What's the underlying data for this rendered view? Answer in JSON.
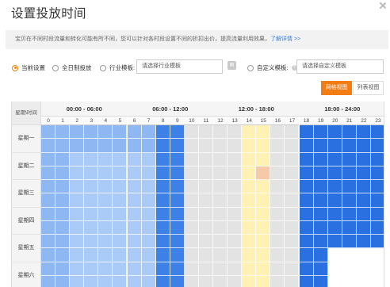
{
  "dialog": {
    "title": "设置投放时间"
  },
  "notice": {
    "text": "宝贝在不同时段流量和转化可能有所不同，您可以针对各时段设置不同的折扣出价，提高流量利用效果，",
    "link": "了解详情 >>"
  },
  "options": {
    "current": "当前设置",
    "allday": "全日制投放",
    "industry": "行业模板:",
    "industry_placeholder": "请选择行业模板",
    "custom": "自定义模板:",
    "custom_placeholder": "请选择自定义模板",
    "selected": "current"
  },
  "view": {
    "grid": "网格视图",
    "list": "列表视图",
    "active": "grid"
  },
  "schedule": {
    "corner": "星期\\时间",
    "quarters": [
      "00:00 - 06:00",
      "06:00 - 12:00",
      "12:00 - 18:00",
      "18:00 - 24:00"
    ],
    "hours": [
      "0",
      "1",
      "2",
      "3",
      "4",
      "5",
      "6",
      "7",
      "8",
      "9",
      "10",
      "11",
      "12",
      "13",
      "14",
      "15",
      "16",
      "17",
      "18",
      "19",
      "20",
      "21",
      "22",
      "23"
    ],
    "days": [
      "星期一",
      "星期二",
      "星期三",
      "星期四",
      "星期五",
      "星期六"
    ],
    "hour_colors": [
      "#8fb7f2",
      "#8fb7f2",
      "#aacbf7",
      "#aacbf7",
      "#aacbf7",
      "#aacbf7",
      "#aacbf7",
      "#aacbf7",
      "#3d80e8",
      "#3d80e8",
      "#e3e3e3",
      "#e3e3e3",
      "#e3e3e3",
      "#e3e3e3",
      "#fff0b3",
      "#fff0b3",
      "#e3e3e3",
      "#e3e3e3",
      "#2a70e0",
      "#2a70e0",
      "#2a70e0",
      "#2a70e0",
      "#2a70e0",
      "#2a70e0"
    ],
    "row1_colors": [
      "#8fb7f2",
      "#8fb7f2",
      "#8fb7f2",
      "#8fb7f2",
      "#8fb7f2",
      "#8fb7f2",
      "#8fb7f2",
      "#8fb7f2",
      "#3d80e8",
      "#3d80e8",
      "#e3e3e3",
      "#e3e3e3",
      "#e3e3e3",
      "#e3e3e3",
      "#fff0b3",
      "#fff0b3",
      "#e3e3e3",
      "#e3e3e3",
      "#2a70e0",
      "#2a70e0",
      "#2a70e0",
      "#2a70e0",
      "#2a70e0",
      "#2a70e0"
    ],
    "highlight_color": "#f6c9a8",
    "white_color": "#ffffff"
  }
}
